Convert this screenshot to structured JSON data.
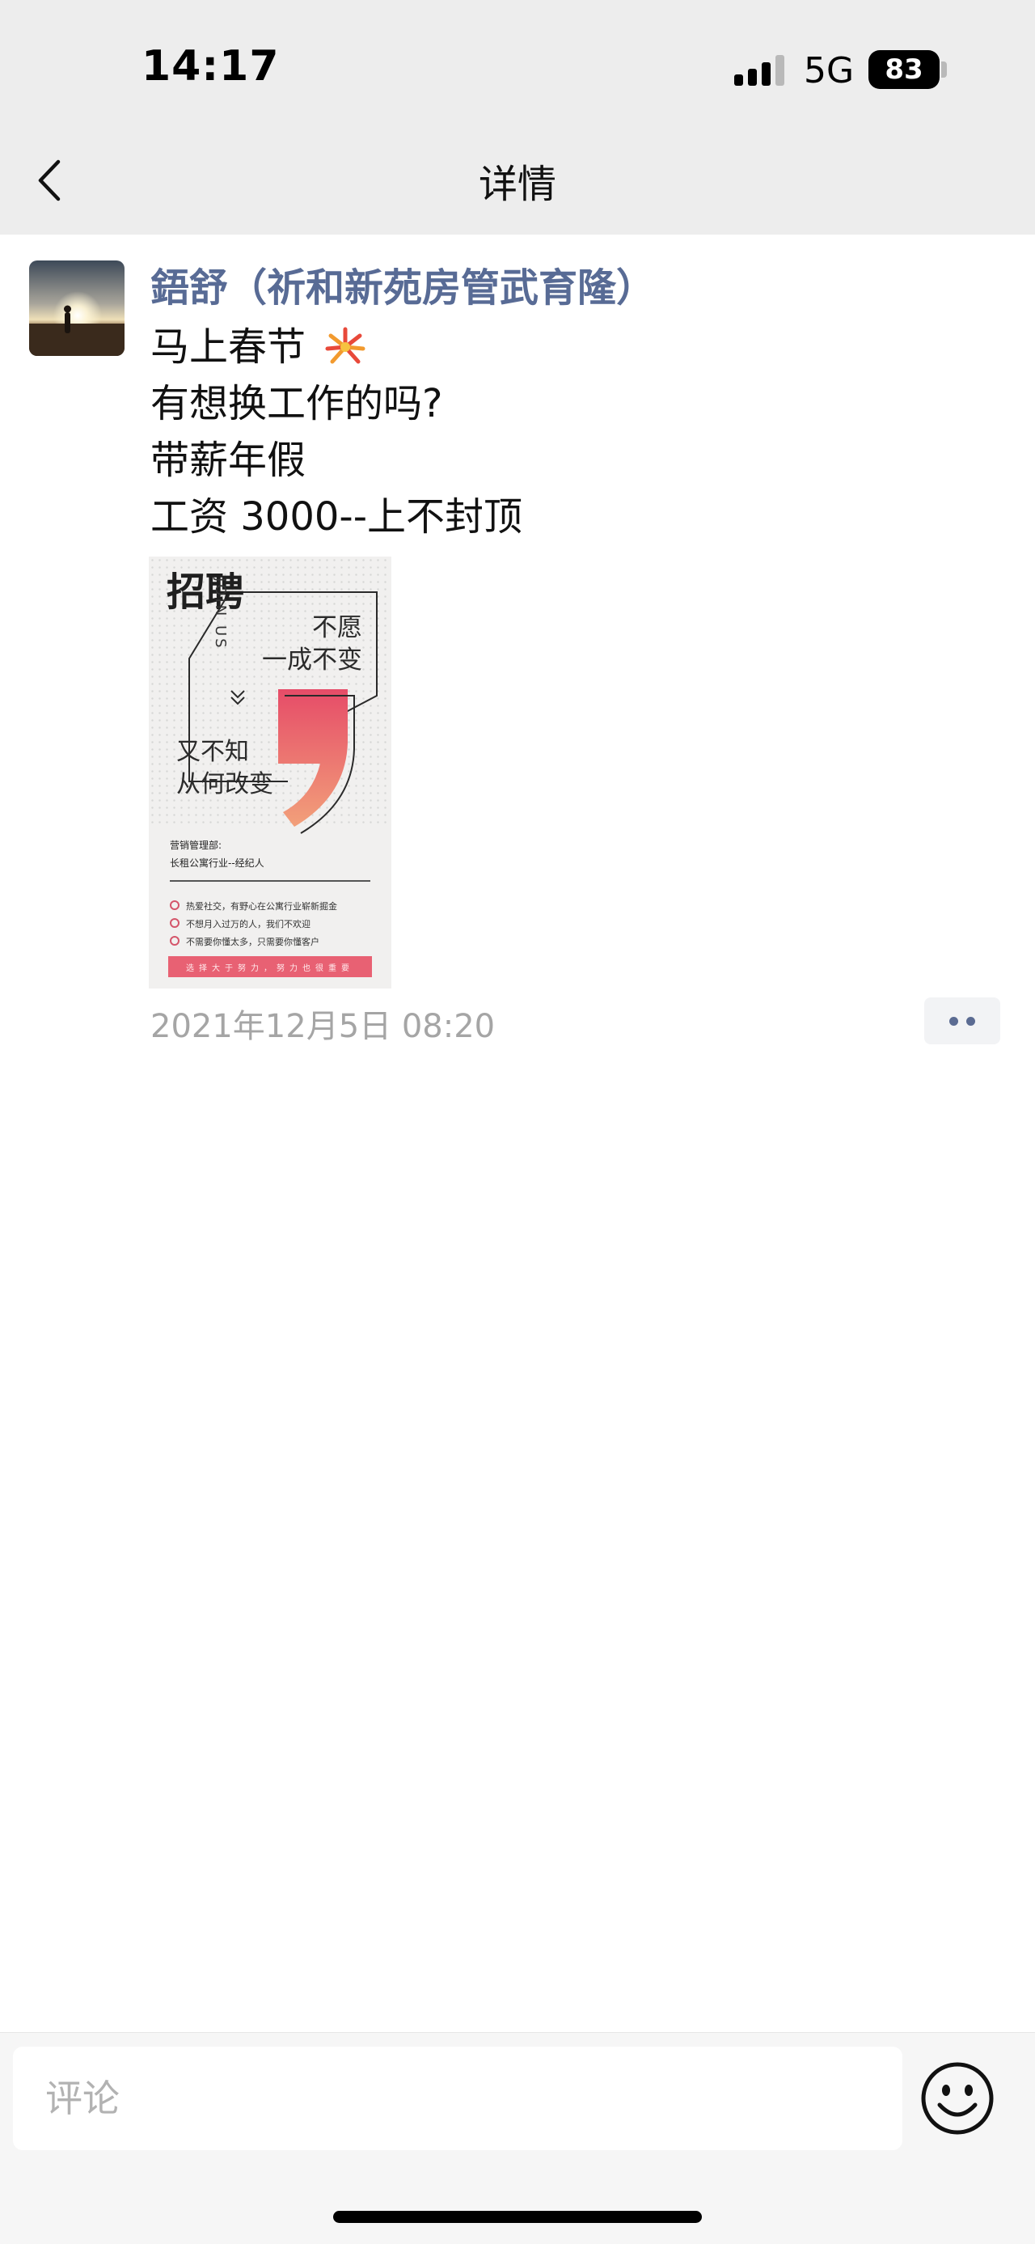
{
  "status_bar": {
    "time": "14:17",
    "network": "5G",
    "battery": "83"
  },
  "nav": {
    "title": "详情"
  },
  "post": {
    "author": "鋙舒（祈和新苑房管武育隆）",
    "lines": [
      "马上春节",
      "有想换工作的吗?",
      "带薪年假",
      "工资 3000--上不封顶"
    ],
    "emoji_after_first_line": "fireworks-icon",
    "time": "2021年12月5日 08:20",
    "image": {
      "title": "招聘",
      "join_us": "JOIN US",
      "slogan_1": "不愿\n一成不变",
      "slogan_2": "又不知\n从何改变",
      "dept": "营销管理部:",
      "role": "长租公寓行业--经纪人",
      "requirements": [
        "热爱社交，有野心在公寓行业崭新掘金",
        "不想月入过万的人，我们不欢迎",
        "不需要你懂太多，只需要你懂客户"
      ],
      "footer": "选择大于努力，努力也很重要"
    }
  },
  "comment": {
    "placeholder": "评论"
  },
  "colors": {
    "author": "#586b95",
    "poster_accent": "#e86173"
  }
}
